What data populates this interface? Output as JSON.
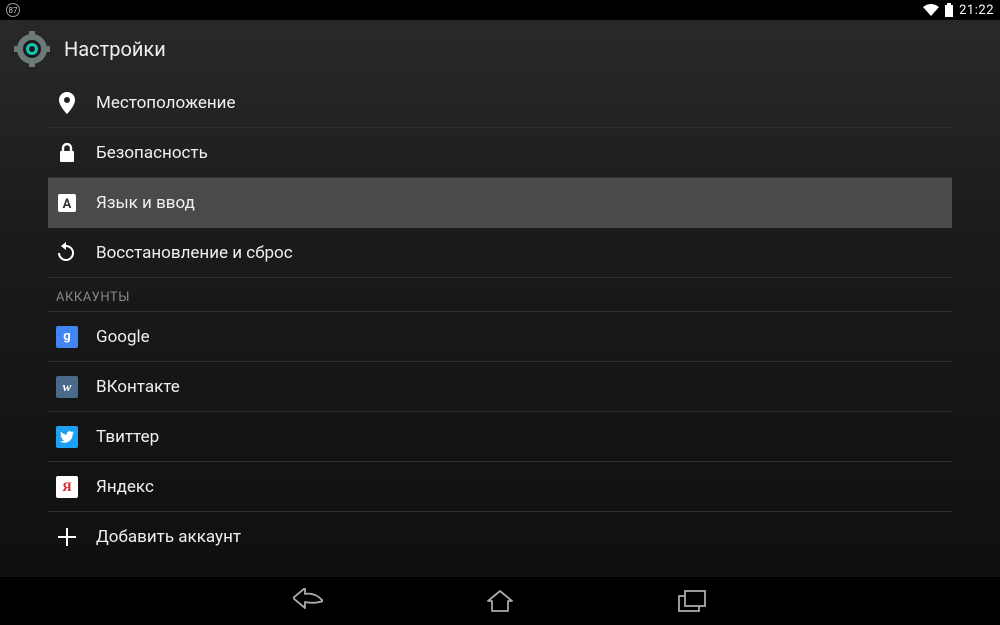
{
  "status": {
    "indicator": "87",
    "time": "21:22"
  },
  "header": {
    "title": "Настройки"
  },
  "items": {
    "location": "Местоположение",
    "security": "Безопасность",
    "language_input": "Язык и ввод",
    "backup_reset": "Восстановление и сброс",
    "add_account": "Добавить аккаунт"
  },
  "section": {
    "accounts": "АККАУНТЫ"
  },
  "accounts": {
    "google": "Google",
    "vk": "ВКонтакте",
    "twitter": "Твиттер",
    "yandex": "Яндекс"
  },
  "account_badges": {
    "google": "g",
    "vk": "w",
    "yandex": "Я"
  }
}
